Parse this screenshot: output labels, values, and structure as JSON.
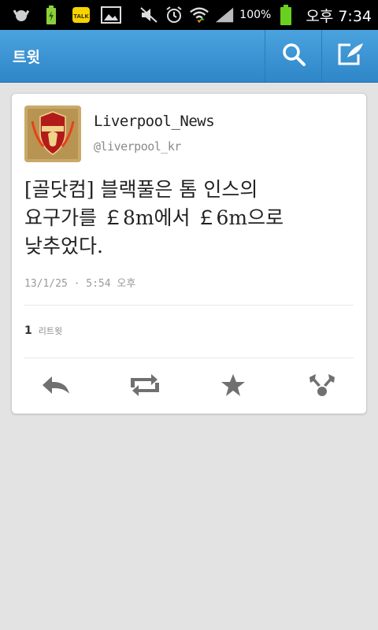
{
  "status_bar": {
    "battery_percent": "100%",
    "time_period": "오후",
    "time": "7:34",
    "icons": [
      "android-icon",
      "battery-charging-icon",
      "kakaotalk-icon",
      "gallery-icon",
      "mute-icon",
      "alarm-icon",
      "wifi-icon",
      "signal-icon",
      "battery-icon"
    ]
  },
  "action_bar": {
    "title": "트윗",
    "actions": [
      "search-icon",
      "compose-icon"
    ]
  },
  "tweet": {
    "author_name": "Liverpool_News",
    "author_handle": "@liverpool_kr",
    "text": "[골닷컴] 블랙풀은 톰 인스의\n요구가를 ￡8m에서 ￡6m으로\n낮추었다.",
    "timestamp": "13/1/25 · 5:54 오후",
    "retweet_count": "1",
    "retweet_label": "리트윗",
    "actions": [
      "reply-icon",
      "retweet-icon",
      "favorite-icon",
      "share-icon"
    ]
  },
  "colors": {
    "action_bar": "#2f86c8",
    "background": "#e3e3e3",
    "card": "#ffffff"
  }
}
